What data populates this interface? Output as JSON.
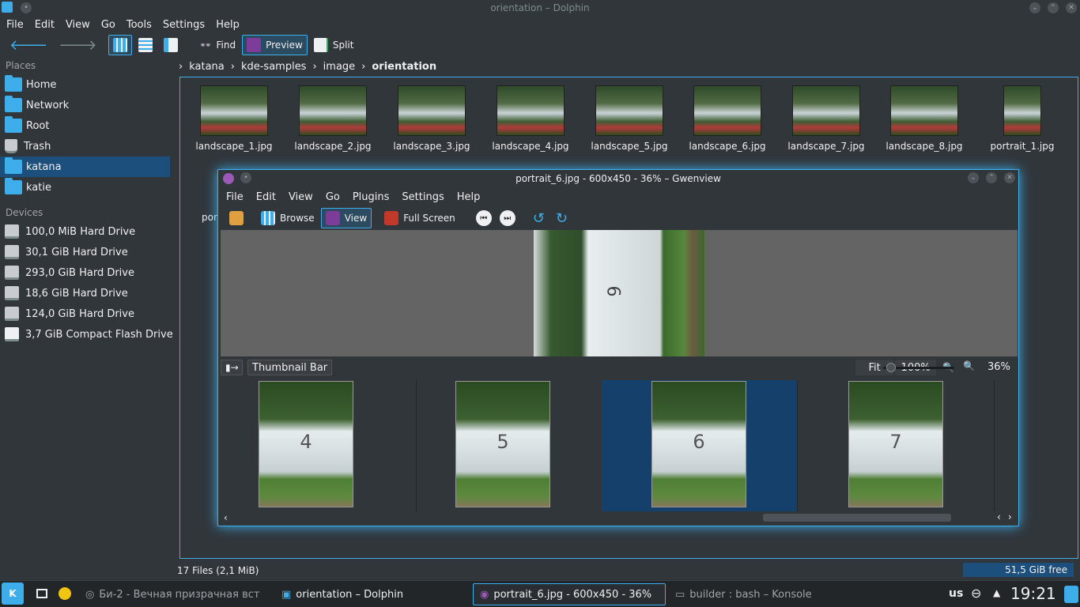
{
  "dolphin": {
    "title": "orientation – Dolphin",
    "menu": [
      "File",
      "Edit",
      "View",
      "Go",
      "Tools",
      "Settings",
      "Help"
    ],
    "toolbar": {
      "find": "Find",
      "preview": "Preview",
      "split": "Split"
    },
    "places_header": "Places",
    "places": [
      "Home",
      "Network",
      "Root",
      "Trash",
      "katana",
      "katie"
    ],
    "devices_header": "Devices",
    "devices": [
      "100,0 MiB Hard Drive",
      "30,1 GiB Hard Drive",
      "293,0 GiB Hard Drive",
      "18,6 GiB Hard Drive",
      "124,0 GiB Hard Drive",
      "3,7 GiB Compact Flash Drive"
    ],
    "breadcrumb": [
      "katana",
      "kde-samples",
      "image",
      "orientation"
    ],
    "files": [
      "landscape_1.jpg",
      "landscape_2.jpg",
      "landscape_3.jpg",
      "landscape_4.jpg",
      "landscape_5.jpg",
      "landscape_6.jpg",
      "landscape_7.jpg",
      "landscape_8.jpg",
      "portrait_1.jpg"
    ],
    "partial_label": "por",
    "status": "17 Files (2,1 MiB)",
    "free": "51,5 GiB free"
  },
  "gwenview": {
    "title": "portrait_6.jpg - 600x450 - 36% – Gwenview",
    "menu": [
      "File",
      "Edit",
      "View",
      "Go",
      "Plugins",
      "Settings",
      "Help"
    ],
    "toolbar": {
      "browse": "Browse",
      "view": "View",
      "fullscreen": "Full Screen"
    },
    "image_number": "6",
    "thumbnail_bar": "Thumbnail Bar",
    "fit": "Fit",
    "zoom_100": "100%",
    "zoom": "36%",
    "zoom_slider_fraction": 0.05,
    "thumbs": [
      "4",
      "5",
      "6",
      "7"
    ]
  },
  "taskbar": {
    "tasks": [
      "Би-2 - Вечная призрачная вст",
      "orientation – Dolphin",
      "portrait_6.jpg - 600x450 - 36%",
      "builder : bash – Konsole"
    ],
    "layout": "us",
    "clock": "19:21"
  },
  "colors": {
    "accent": "#3daee9",
    "selection": "#1d4f7d",
    "bg": "#31363b"
  }
}
